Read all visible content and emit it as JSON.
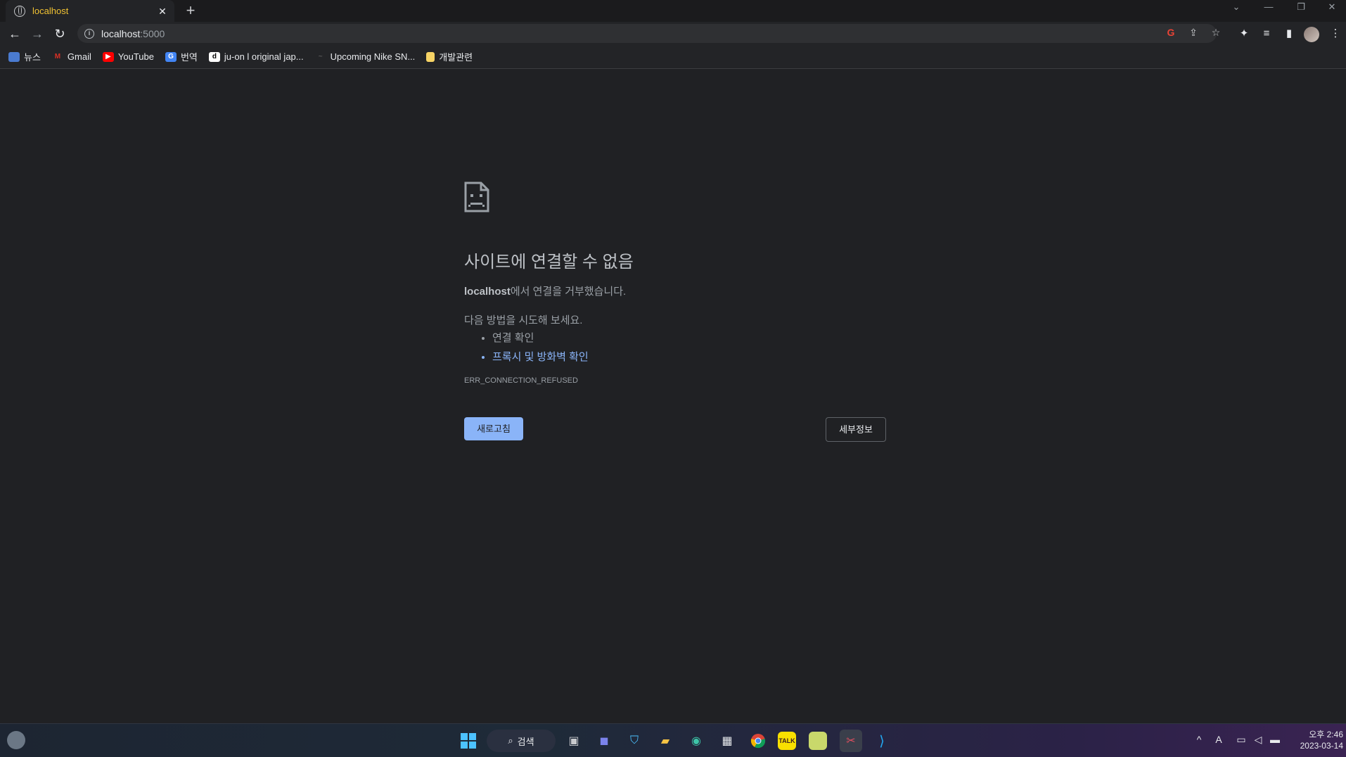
{
  "tab": {
    "title": "localhost",
    "close": "✕",
    "new_tab": "+"
  },
  "window_controls": {
    "dropdown": "⌄",
    "minimize": "—",
    "restore": "❐",
    "close": "✕"
  },
  "toolbar": {
    "back": "←",
    "forward": "→",
    "reload": "↻",
    "url_host": "localhost",
    "url_port": ":5000"
  },
  "bookmarks": [
    {
      "label": "뉴스",
      "icon": "news-icon",
      "color": "#4a7bd0"
    },
    {
      "label": "Gmail",
      "icon": "gmail-icon",
      "color": "#d93025"
    },
    {
      "label": "YouTube",
      "icon": "youtube-icon",
      "color": "#ff0000"
    },
    {
      "label": "번역",
      "icon": "translate-icon",
      "color": "#4285f4"
    },
    {
      "label": "ju-on l original jap...",
      "icon": "d-icon",
      "color": "#ffffff"
    },
    {
      "label": "Upcoming Nike SN...",
      "icon": "nike-icon",
      "color": "#232427"
    },
    {
      "label": "개발관련",
      "icon": "folder-icon",
      "color": "#f6d365"
    }
  ],
  "error": {
    "title": "사이트에 연결할 수 없음",
    "host": "localhost",
    "desc_suffix": "에서 연결을 거부했습니다.",
    "suggest_heading": "다음 방법을 시도해 보세요.",
    "suggest_items": [
      "연결 확인",
      "프록시 및 방화벽 확인"
    ],
    "code": "ERR_CONNECTION_REFUSED",
    "reload_label": "새로고침",
    "details_label": "세부정보"
  },
  "taskbar": {
    "search_label": "검색",
    "time": "오후 2:46",
    "date": "2023-03-14",
    "ime": "A"
  },
  "colors": {
    "background": "#202124",
    "link": "#8ab4f8",
    "reload_button": "#8ab4f8",
    "tab_title": "#f1c232"
  }
}
